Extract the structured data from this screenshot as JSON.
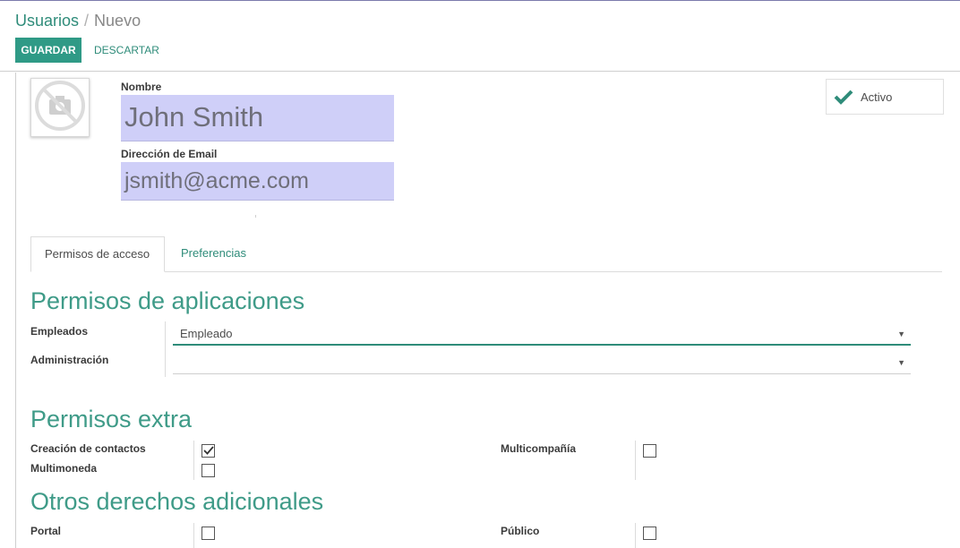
{
  "breadcrumb": {
    "parent": "Usuarios",
    "separator": "/",
    "current": "Nuevo"
  },
  "toolbar": {
    "save_label": "GUARDAR",
    "discard_label": "DESCARTAR"
  },
  "form": {
    "name_label": "Nombre",
    "name_value": "John Smith",
    "email_label": "Dirección de Email",
    "email_value": "jsmith@acme.com",
    "active_label": "Activo"
  },
  "tabs": [
    {
      "label": "Permisos de acceso",
      "active": true
    },
    {
      "label": "Preferencias",
      "active": false
    }
  ],
  "app_permissions": {
    "title": "Permisos de aplicaciones",
    "rows": [
      {
        "label": "Empleados",
        "value": "Empleado"
      },
      {
        "label": "Administración",
        "value": ""
      }
    ]
  },
  "extra_permissions": {
    "title": "Permisos extra",
    "items": [
      {
        "label": "Creación de contactos",
        "checked": true
      },
      {
        "label": "Multicompañía",
        "checked": false
      },
      {
        "label": "Multimoneda",
        "checked": false
      }
    ]
  },
  "other_rights": {
    "title": "Otros derechos adicionales",
    "items": [
      {
        "label": "Portal",
        "checked": false
      },
      {
        "label": "Público",
        "checked": false
      }
    ]
  },
  "colors": {
    "accent": "#2f9a86",
    "link": "#2f8c7a",
    "required_field": "#cfcff8",
    "active_check": "#2f8c7a"
  }
}
